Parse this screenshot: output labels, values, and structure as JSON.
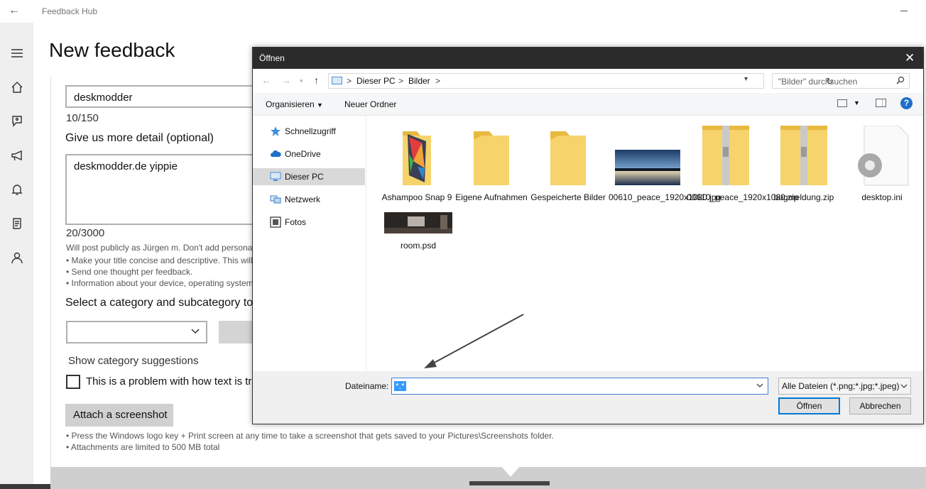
{
  "app": {
    "title": "Feedback Hub",
    "back_glyph": "←",
    "page_title": "New feedback"
  },
  "nav": {
    "items": [
      {
        "name": "menu-icon"
      },
      {
        "name": "home-icon"
      },
      {
        "name": "feedback-icon"
      },
      {
        "name": "announcements-icon"
      },
      {
        "name": "notifications-icon"
      },
      {
        "name": "quests-icon"
      },
      {
        "name": "profile-icon"
      }
    ]
  },
  "form": {
    "title_value": "deskmodder",
    "title_count": "10/150",
    "detail_label": "Give us more detail (optional)",
    "detail_value": "deskmodder.de yippie",
    "detail_count": "20/3000",
    "post_note": "Will post publicly as Jürgen m. Don't add personal",
    "tips": [
      "• Make your title concise and descriptive. This will",
      "• Send one thought per feedback.",
      "• Information about your device, operating system"
    ],
    "category_label": "Select a category and subcategory to",
    "show_suggestions": "Show category suggestions",
    "checkbox_label": "This is a problem with how text is tr",
    "attach_button": "Attach a screenshot",
    "attach_notes": [
      "• Press the Windows logo key + Print screen at any time to take a screenshot that gets saved to your Pictures\\Screenshots folder.",
      "• Attachments are limited to 500 MB total"
    ]
  },
  "dialog": {
    "title": "Öffnen",
    "close_glyph": "✕",
    "address": {
      "crumbs": [
        "Dieser PC",
        "Bilder"
      ],
      "separator": ">"
    },
    "search_placeholder": "\"Bilder\" durchsuchen",
    "toolbar": {
      "organize": "Organisieren",
      "new_folder": "Neuer Ordner",
      "help": "?"
    },
    "sidebar": [
      {
        "label": "Schnellzugriff",
        "icon": "star-icon",
        "color": "#3b8fd9"
      },
      {
        "label": "OneDrive",
        "icon": "cloud-icon",
        "color": "#1e6fc9"
      },
      {
        "label": "Dieser PC",
        "icon": "computer-icon",
        "color": "#4a90d9",
        "selected": true
      },
      {
        "label": "Netzwerk",
        "icon": "network-icon",
        "color": "#3d7cc9"
      },
      {
        "label": "Fotos",
        "icon": "photos-icon",
        "color": "#555555"
      }
    ],
    "files": [
      {
        "name": "Ashampoo Snap 9",
        "kind": "folder-app"
      },
      {
        "name": "Eigene Aufnahmen",
        "kind": "folder"
      },
      {
        "name": "Gespeicherte Bilder",
        "kind": "folder"
      },
      {
        "name": "00610_peace_1920x1080.jpg",
        "kind": "image"
      },
      {
        "name": "00610_peace_1920x1080.zip",
        "kind": "zip"
      },
      {
        "name": "bugmeldung.zip",
        "kind": "zip"
      },
      {
        "name": "desktop.ini",
        "kind": "ini"
      },
      {
        "name": "room.psd",
        "kind": "psd"
      }
    ],
    "filename_label": "Dateiname:",
    "filename_value": "*.*",
    "filetype_value": "Alle Dateien (*.png;*.jpg;*.jpeg)",
    "open_button": "Öffnen",
    "cancel_button": "Abbrechen"
  },
  "colors": {
    "folder_yellow": "#f6d36b",
    "accent": "#0078d7",
    "help_blue": "#1e6fc9"
  }
}
